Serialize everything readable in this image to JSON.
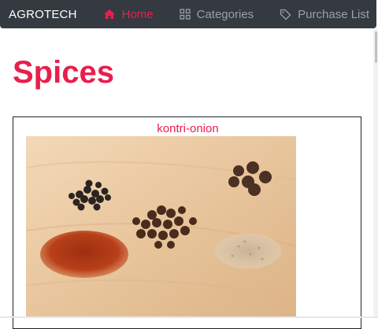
{
  "navbar": {
    "brand": "AGROTECH",
    "items": [
      {
        "label": "Home",
        "icon": "home-icon",
        "active": true
      },
      {
        "label": "Categories",
        "icon": "grid-icon",
        "active": false
      },
      {
        "label": "Purchase List",
        "icon": "tag-icon",
        "active": false
      }
    ]
  },
  "page": {
    "title": "Spices"
  },
  "card": {
    "title": "kontri-onion",
    "image_alt": "spices"
  },
  "colors": {
    "accent": "#e91e4d",
    "navbar_bg": "#343a40",
    "nav_inactive": "#9aa0a6"
  }
}
